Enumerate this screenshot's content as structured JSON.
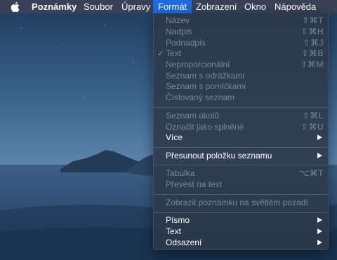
{
  "menubar": {
    "app_name": "Poznámky",
    "menus": [
      "Soubor",
      "Úpravy",
      "Formát",
      "Zobrazení",
      "Okno",
      "Nápověda"
    ]
  },
  "format_menu": {
    "title": "Formát",
    "items": [
      {
        "label": "Název",
        "shortcut": "⇧⌘T",
        "enabled": false
      },
      {
        "label": "Nadpis",
        "shortcut": "⇧⌘H",
        "enabled": false
      },
      {
        "label": "Podnadpis",
        "shortcut": "⇧⌘J",
        "enabled": false
      },
      {
        "label": "Text",
        "shortcut": "⇧⌘B",
        "enabled": false,
        "checked": true
      },
      {
        "label": "Neproporcionální",
        "shortcut": "⇧⌘M",
        "enabled": false
      },
      {
        "label": "Seznam s odrážkami",
        "enabled": false
      },
      {
        "label": "Seznam s pomlčkami",
        "enabled": false
      },
      {
        "label": "Číslovaný seznam",
        "enabled": false
      },
      {
        "label": "Seznam úkolů",
        "shortcut": "⇧⌘L",
        "enabled": false
      },
      {
        "label": "Označit jako splněné",
        "shortcut": "⇧⌘U",
        "enabled": false
      },
      {
        "label": "Více",
        "submenu": true,
        "enabled": true
      },
      {
        "label": "Přesunout položku seznamu",
        "submenu": true,
        "enabled": true
      },
      {
        "label": "Tabulka",
        "shortcut": "⌥⌘T",
        "enabled": false
      },
      {
        "label": "Převést na text",
        "enabled": false
      },
      {
        "label": "Zobrazit poznámku na světlém pozadí",
        "enabled": false
      },
      {
        "label": "Písmo",
        "submenu": true,
        "enabled": true
      },
      {
        "label": "Text",
        "submenu": true,
        "enabled": true
      },
      {
        "label": "Odsazení",
        "submenu": true,
        "enabled": true
      }
    ],
    "check_mark": "✓"
  },
  "colors": {
    "menubar_bg": "#3a4256",
    "active_menu": "#1e6ae0",
    "menu_bg": "#2c384a",
    "disabled_text": "#7b8798"
  }
}
